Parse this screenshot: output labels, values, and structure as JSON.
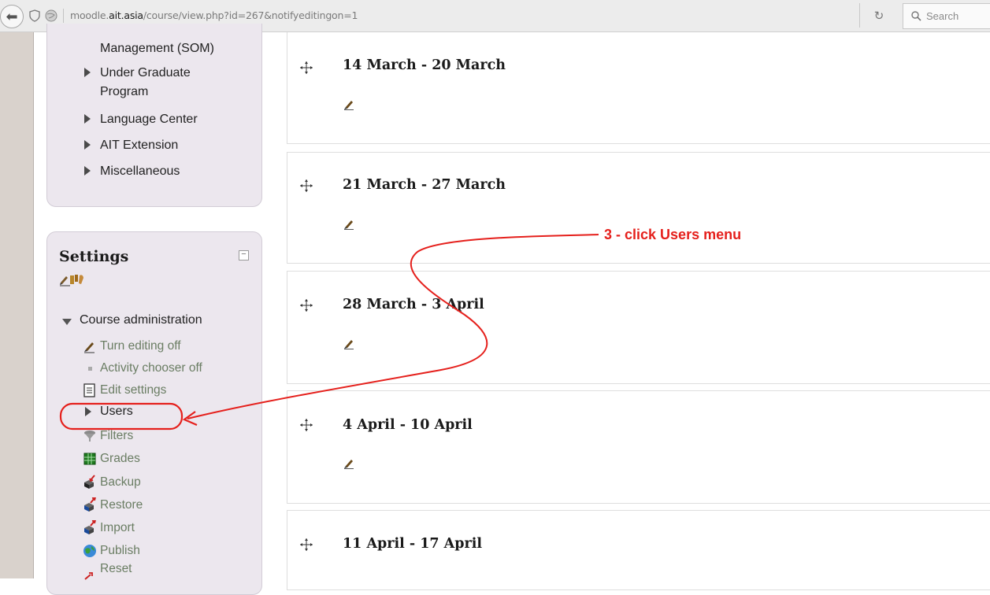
{
  "browser": {
    "url_prefix": "moodle.",
    "url_host": "ait.asia",
    "url_path": "/course/view.php?id=267&notifyeditingon=1",
    "search_placeholder": "Search"
  },
  "navigation": {
    "top_partial": "Management (SOM)",
    "items": [
      {
        "line1": "Under Graduate",
        "line2": "Program"
      },
      {
        "line1": "Language Center"
      },
      {
        "line1": "AIT Extension"
      },
      {
        "line1": "Miscellaneous"
      }
    ]
  },
  "settings": {
    "title": "Settings",
    "course_admin_label": "Course administration",
    "admin_items": {
      "turn_editing": "Turn editing off",
      "activity_chooser": "Activity chooser off",
      "edit_settings": "Edit settings",
      "users": "Users",
      "filters": "Filters",
      "grades": "Grades",
      "backup": "Backup",
      "restore": "Restore",
      "import": "Import",
      "publish": "Publish",
      "reset": "Reset"
    }
  },
  "sections": [
    {
      "title": "14 March - 20 March"
    },
    {
      "title": "21 March - 27 March"
    },
    {
      "title": "28 March - 3 April"
    },
    {
      "title": "4 April - 10 April"
    },
    {
      "title": "11 April - 17 April"
    }
  ],
  "annotation": {
    "label": "3 - click Users menu",
    "color": "#e5201c"
  }
}
